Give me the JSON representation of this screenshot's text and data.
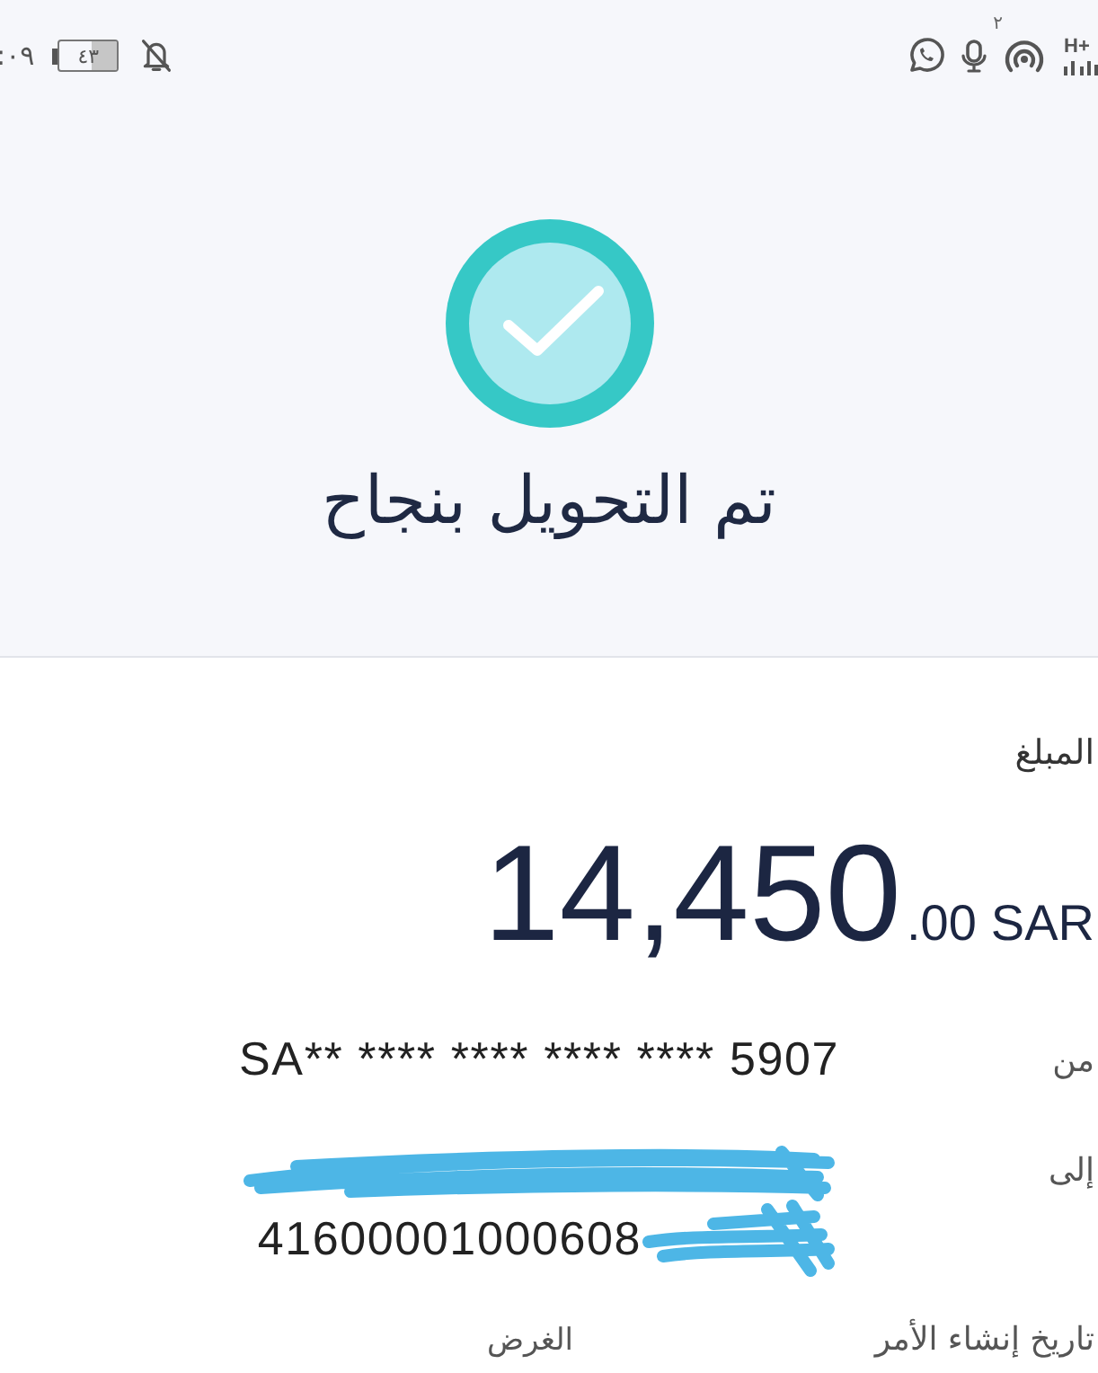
{
  "status_bar": {
    "time": ":٠٩",
    "battery": "٤٣",
    "badge": "٢",
    "network": "H+"
  },
  "success": {
    "title": "تم التحويل بنجاح"
  },
  "amount": {
    "label": "المبلغ",
    "value": "14,450",
    "fraction": ".00",
    "currency": "SAR"
  },
  "details": [
    {
      "label": "من",
      "value": "SA** **** **** **** **** 5907",
      "redacted": false
    },
    {
      "label": "إلى",
      "value": "41600001000608",
      "redacted": true
    }
  ],
  "footer_labels": [
    "تاريخ إنشاء الأمر",
    "الغرض"
  ]
}
